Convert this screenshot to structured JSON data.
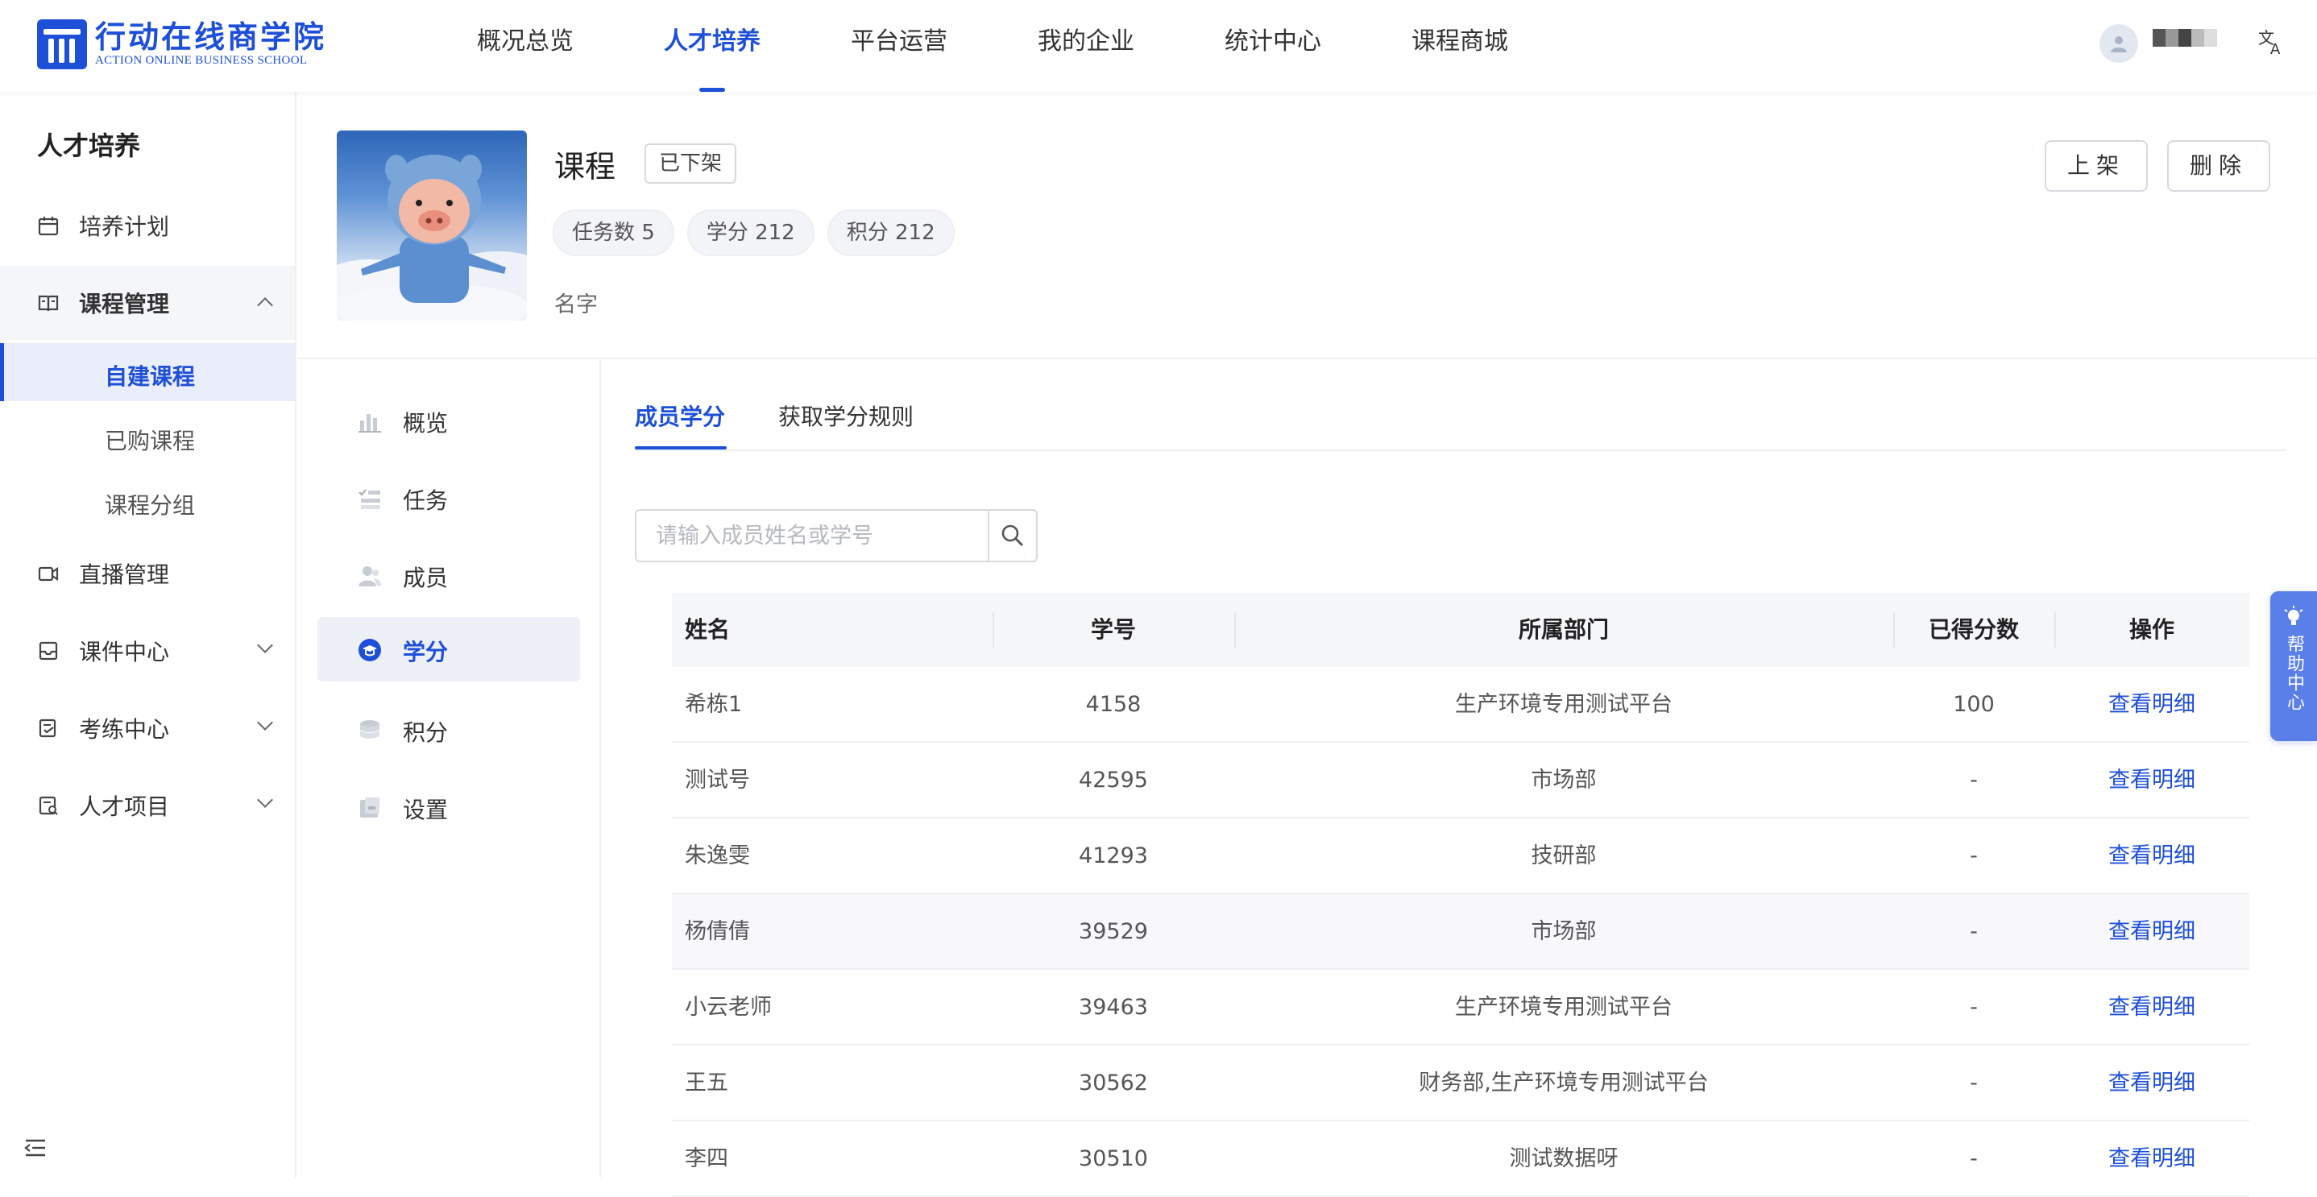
{
  "brand": {
    "name_cn": "行动在线商学院",
    "name_en": "ACTION ONLINE BUSINESS SCHOOL",
    "color": "#1e4fd8"
  },
  "topnav": {
    "items": [
      {
        "label": "概况总览",
        "active": false
      },
      {
        "label": "人才培养",
        "active": true
      },
      {
        "label": "平台运营",
        "active": false
      },
      {
        "label": "我的企业",
        "active": false
      },
      {
        "label": "统计中心",
        "active": false
      },
      {
        "label": "课程商城",
        "active": false
      }
    ],
    "lang_icon": "translate-icon",
    "avatar_icon": "user-avatar-icon"
  },
  "sidebar": {
    "title": "人才培养",
    "items": [
      {
        "label": "培养计划",
        "icon": "calendar-icon"
      },
      {
        "label": "课程管理",
        "icon": "book-icon",
        "expanded": true
      },
      {
        "label": "直播管理",
        "icon": "video-icon"
      },
      {
        "label": "课件中心",
        "icon": "inbox-icon"
      },
      {
        "label": "考练中心",
        "icon": "exam-icon"
      },
      {
        "label": "人才项目",
        "icon": "project-icon"
      }
    ],
    "subitems": [
      {
        "label": "自建课程",
        "active": true
      },
      {
        "label": "已购课程",
        "active": false
      },
      {
        "label": "课程分组",
        "active": false
      }
    ]
  },
  "course": {
    "title": "课程",
    "status": "已下架",
    "chips": [
      "任务数 5",
      "学分 212",
      "积分 212"
    ],
    "name": "名字",
    "actions": {
      "publish": "上架",
      "delete": "删除"
    }
  },
  "secnav": {
    "items": [
      {
        "label": "概览",
        "icon": "bar-chart-icon",
        "active": false
      },
      {
        "label": "任务",
        "icon": "task-list-icon",
        "active": false
      },
      {
        "label": "成员",
        "icon": "members-icon",
        "active": false
      },
      {
        "label": "学分",
        "icon": "graduation-cap-icon",
        "active": true
      },
      {
        "label": "积分",
        "icon": "coins-icon",
        "active": false
      },
      {
        "label": "设置",
        "icon": "settings-icon",
        "active": false
      }
    ]
  },
  "tabs": [
    {
      "label": "成员学分",
      "active": true
    },
    {
      "label": "获取学分规则",
      "active": false
    }
  ],
  "search": {
    "placeholder": "请输入成员姓名或学号",
    "value": ""
  },
  "table": {
    "columns": [
      "姓名",
      "学号",
      "所属部门",
      "已得分数",
      "操作"
    ],
    "rows": [
      {
        "name": "希栋1",
        "id": "4158",
        "dept": "生产环境专用测试平台",
        "score": "100",
        "op": "查看明细"
      },
      {
        "name": "测试号",
        "id": "42595",
        "dept": "市场部",
        "score": "-",
        "op": "查看明细"
      },
      {
        "name": "朱逸雯",
        "id": "41293",
        "dept": "技研部",
        "score": "-",
        "op": "查看明细"
      },
      {
        "name": "杨倩倩",
        "id": "39529",
        "dept": "市场部",
        "score": "-",
        "op": "查看明细"
      },
      {
        "name": "小云老师",
        "id": "39463",
        "dept": "生产环境专用测试平台",
        "score": "-",
        "op": "查看明细"
      },
      {
        "name": "王五",
        "id": "30562",
        "dept": "财务部,生产环境专用测试平台",
        "score": "-",
        "op": "查看明细"
      },
      {
        "name": "李四",
        "id": "30510",
        "dept": "测试数据呀",
        "score": "-",
        "op": "查看明细"
      }
    ]
  },
  "help": {
    "label": "帮助中心",
    "icon": "lightbulb-icon"
  }
}
